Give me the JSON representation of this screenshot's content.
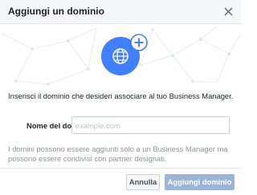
{
  "dialog": {
    "title": "Aggiungi un dominio"
  },
  "hero": {
    "icon": "globe-icon",
    "badge_icon": "plus-icon",
    "accent_color": "#4080ff"
  },
  "body": {
    "intro": "Inserisci il dominio che desideri associare al tuo Business Manager.",
    "domain_field": {
      "label": "Nome del dominio",
      "placeholder": "example.com",
      "value": ""
    },
    "note": "I domini possono essere aggiunti solo a un Business Manager ma possono essere condivisi con partner designati."
  },
  "footer": {
    "cancel_label": "Annulla",
    "add_label": "Aggiungi dominio",
    "add_color": "#9cb4d8"
  }
}
